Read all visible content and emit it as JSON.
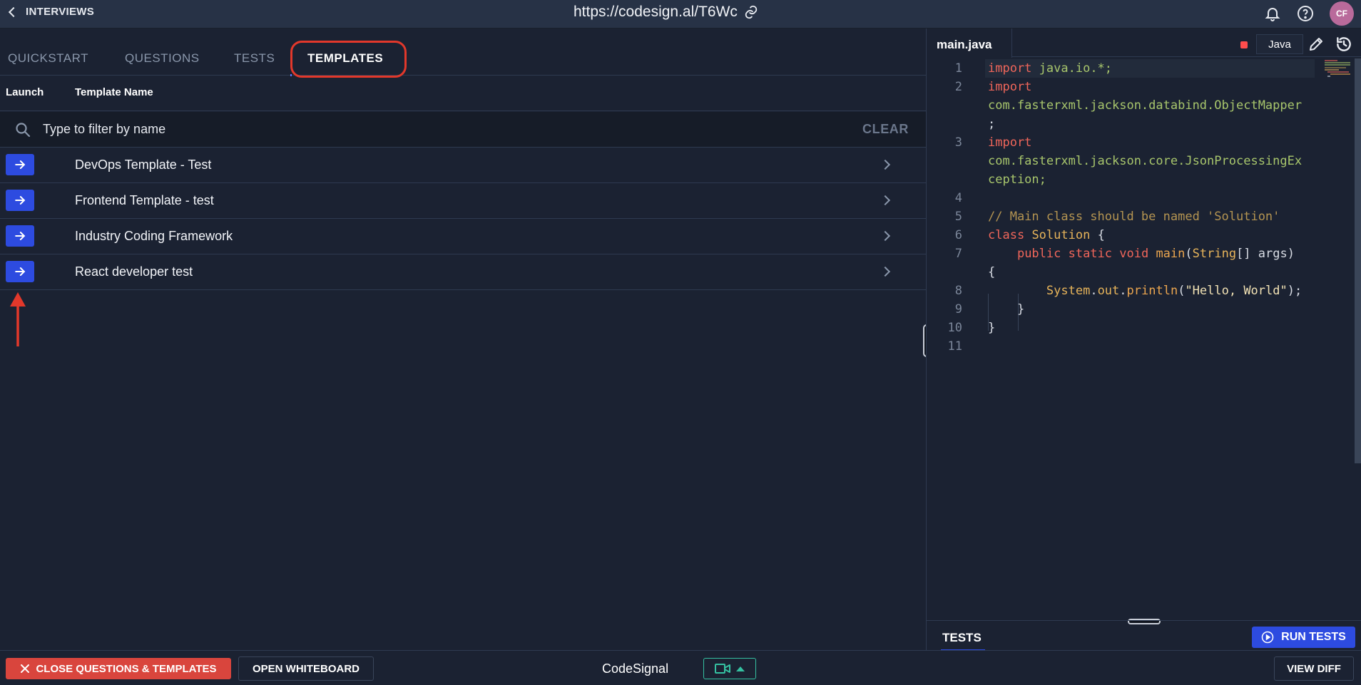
{
  "topbar": {
    "back_label": "INTERVIEWS",
    "url": "https://codesign.al/T6Wc",
    "avatar_initials": "CF"
  },
  "tabs": [
    {
      "label": "QUICKSTART",
      "active": false
    },
    {
      "label": "QUESTIONS",
      "active": false
    },
    {
      "label": "TESTS",
      "active": false
    },
    {
      "label": "TEMPLATES",
      "active": true
    }
  ],
  "table": {
    "columns": [
      "Launch",
      "Template Name"
    ],
    "filter_placeholder": "Type to filter by name",
    "clear_label": "CLEAR",
    "rows": [
      {
        "name": "DevOps Template - Test"
      },
      {
        "name": "Frontend Template - test"
      },
      {
        "name": "Industry Coding Framework"
      },
      {
        "name": "React developer test"
      }
    ]
  },
  "editor": {
    "file_name": "main.java",
    "language": "Java",
    "line_numbers": [
      "1",
      "2",
      "3",
      "4",
      "5",
      "6",
      "7",
      "8",
      "9",
      "10",
      "11"
    ],
    "code_text": {
      "l1_kw": "import",
      "l1_pkg": "java.io.*;",
      "l2_kw": "import",
      "l2_pkg": "com.fasterxml.jackson.databind.ObjectMapper",
      "l2_end": ";",
      "l3_kw": "import",
      "l3_pkg": "com.fasterxml.jackson.core.JsonProcessingEx",
      "l3_pkg2": "ception;",
      "l5_comment": "// Main class should be named 'Solution'",
      "l6_kw": "class",
      "l6_name": "Solution",
      "l6_brace": "{",
      "l7_mods": "public static void",
      "l7_fn": "main",
      "l7_type": "String",
      "l7_rest": "[] args)",
      "l7_open": "(",
      "l7_brace": "{",
      "l8_sys": "System",
      "l8_out": "out",
      "l8_fn": "println",
      "l8_str": "\"Hello, World\"",
      "l8_end": ");",
      "l9": "}",
      "l10": "}"
    }
  },
  "bottom_panel": {
    "tests_tab": "TESTS",
    "run_tests_label": "RUN TESTS"
  },
  "footer": {
    "close_label": "CLOSE QUESTIONS & TEMPLATES",
    "whiteboard_label": "OPEN WHITEBOARD",
    "brand": "CodeSignal",
    "view_diff_label": "VIEW DIFF"
  },
  "colors": {
    "accent_blue": "#2d4be0",
    "danger_red": "#d9453d",
    "annotation_red": "#e2382b",
    "camera_green": "#35c1a1"
  },
  "icons": [
    "chevron-left-icon",
    "link-icon",
    "bell-icon",
    "help-icon",
    "search-icon",
    "arrow-right-icon",
    "chevron-right-icon",
    "pencil-icon",
    "reset-icon",
    "play-circle-icon",
    "close-icon",
    "video-camera-icon",
    "caret-up-icon"
  ]
}
